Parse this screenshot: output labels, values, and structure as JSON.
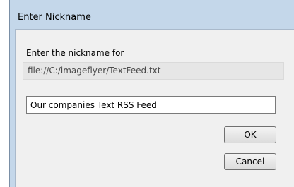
{
  "window": {
    "title": "Enter Nickname"
  },
  "form": {
    "prompt": "Enter the nickname for",
    "file_path": "file://C:/imageflyer/TextFeed.txt",
    "nickname_value": "Our companies Text RSS Feed"
  },
  "buttons": {
    "ok_label": "OK",
    "cancel_label": "Cancel"
  },
  "colors": {
    "window_frame": "#c4d7ea",
    "client_background": "#f0f0f0",
    "readonly_field": "#e6e6e6"
  }
}
